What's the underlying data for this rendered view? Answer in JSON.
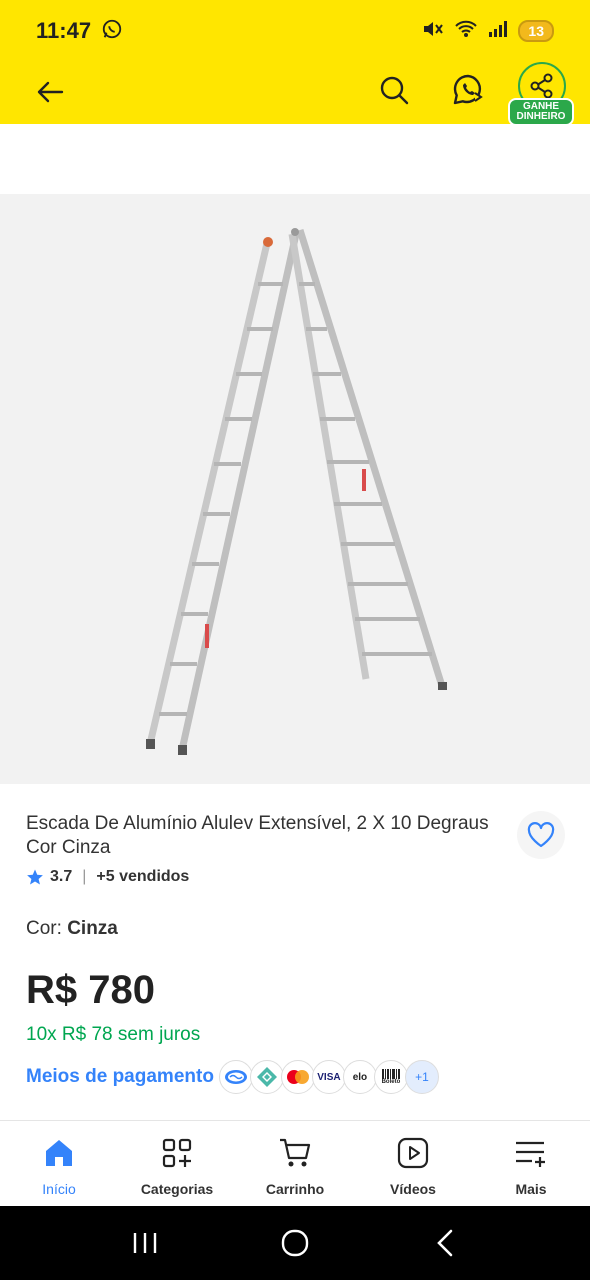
{
  "status": {
    "time": "11:47",
    "battery": "13"
  },
  "top_nav": {
    "share_badge": "GANHE DINHEIRO"
  },
  "product": {
    "title": "Escada De Alumínio Alulev Extensível, 2 X 10 Degraus Cor Cinza",
    "rating": "3.7",
    "sold": "+5 vendidos",
    "color_label": "Cor: ",
    "color_value": "Cinza",
    "price": "R$ 780",
    "installments": "10x R$ 78 sem juros",
    "payment_link": "Meios de pagamento",
    "payment_icons": [
      "mercado-pago-icon",
      "pix-icon",
      "mastercard-icon",
      "visa-icon",
      "elo-icon",
      "boleto-icon"
    ],
    "visa": "VISA",
    "elo": "elo",
    "boleto": "Boleto",
    "payment_more": "+1"
  },
  "bottom_nav": {
    "items": [
      {
        "label": "Início",
        "icon": "home-icon"
      },
      {
        "label": "Categorias",
        "icon": "categories-icon"
      },
      {
        "label": "Carrinho",
        "icon": "cart-icon"
      },
      {
        "label": "Vídeos",
        "icon": "videos-icon"
      },
      {
        "label": "Mais",
        "icon": "more-icon"
      }
    ]
  },
  "colors": {
    "brand_yellow": "#ffe600",
    "link_blue": "#3483fa",
    "green": "#00a650",
    "share_green": "#2ba84a"
  }
}
